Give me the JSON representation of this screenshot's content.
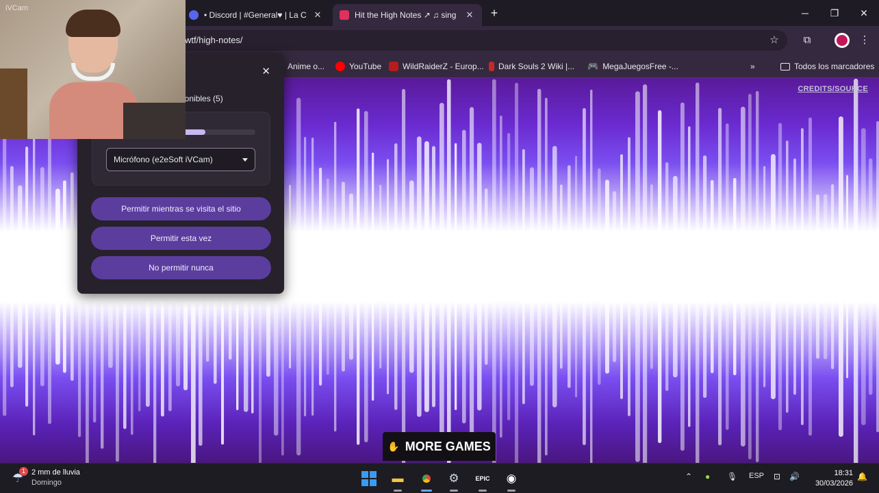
{
  "browser": {
    "tabs": [
      {
        "title": "• Discord | #General♥ | La Ca",
        "active": false
      },
      {
        "title": "Hit the High Notes ↗ ♫ sing",
        "active": true
      }
    ],
    "url": "wtf/high-notes/",
    "bookmarks": [
      {
        "label": "Anime o...",
        "icon": "anime-icon"
      },
      {
        "label": "YouTube",
        "icon": "youtube-icon"
      },
      {
        "label": "WildRaiderZ - Europ...",
        "icon": "wildraiderz-icon"
      },
      {
        "label": "Dark Souls 2 Wiki |...",
        "icon": "darksouls-icon"
      },
      {
        "label": "MegaJuegosFree -...",
        "icon": "gamepad-icon"
      }
    ],
    "all_bookmarks_label": "Todos los marcadores"
  },
  "page": {
    "credits_label": "CREDITS/SOURCE",
    "more_games_label": "MORE GAMES"
  },
  "permission_popup": {
    "devices_text": "ponibles (5)",
    "mic_level": 0.4,
    "selected_device": "Micrófono (e2eSoft iVCam)",
    "buttons": {
      "allow_while_visiting": "Permitir mientras se visita el sitio",
      "allow_once": "Permitir esta vez",
      "never_allow": "No permitir nunca"
    }
  },
  "webcam": {
    "label": "iVCam"
  },
  "taskbar": {
    "weather": {
      "badge": "1",
      "line1": "2 mm de lluvia",
      "line2": "Domingo"
    },
    "language": "ESP",
    "time": "18:31",
    "date": "30/03/2026"
  },
  "colors": {
    "accent_purple": "#5b3d9e",
    "tab_active": "#35293f",
    "page_purple": "#6a2ad0"
  }
}
